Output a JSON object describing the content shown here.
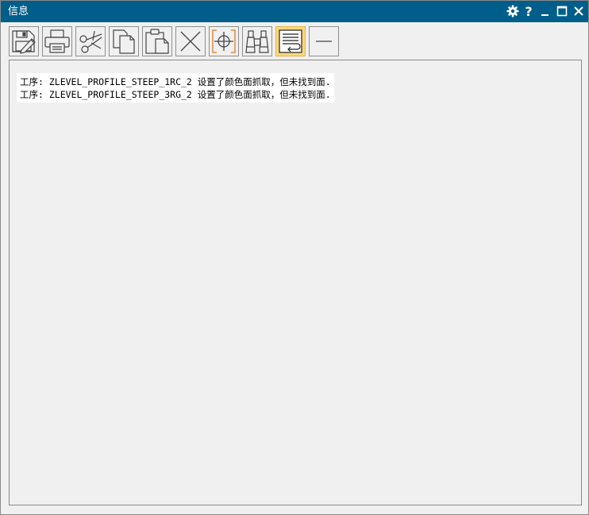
{
  "window": {
    "title": "信息"
  },
  "titlebar_buttons": [
    {
      "name": "settings",
      "icon": "gear-icon"
    },
    {
      "name": "help",
      "icon": "question-icon",
      "glyph": "?"
    },
    {
      "name": "minimize",
      "icon": "minimize-icon"
    },
    {
      "name": "maximize",
      "icon": "maximize-icon"
    },
    {
      "name": "close",
      "icon": "close-icon"
    }
  ],
  "toolbar": {
    "tools": [
      {
        "name": "save",
        "icon": "save-icon"
      },
      {
        "name": "print",
        "icon": "printer-icon"
      },
      {
        "name": "cut",
        "icon": "scissors-icon"
      },
      {
        "name": "copy",
        "icon": "copy-icon"
      },
      {
        "name": "paste",
        "icon": "clipboard-icon"
      },
      {
        "name": "delete",
        "icon": "x-delete-icon"
      },
      {
        "name": "fit",
        "icon": "crosshair-icon"
      },
      {
        "name": "find",
        "icon": "binoculars-icon"
      },
      {
        "name": "word-wrap",
        "icon": "wrap-text-icon",
        "active": true
      },
      {
        "name": "separator-line",
        "icon": "dash-icon"
      }
    ]
  },
  "content": {
    "lines": [
      "工序: ZLEVEL_PROFILE_STEEP_1RC_2 设置了颜色面抓取，但未找到面.",
      "工序: ZLEVEL_PROFILE_STEEP_3RG_2 设置了颜色面抓取，但未找到面."
    ]
  },
  "colors": {
    "titlebar": "#005e8a",
    "active_tool": "#fdd979",
    "accent_orange": "#e07a1f"
  }
}
